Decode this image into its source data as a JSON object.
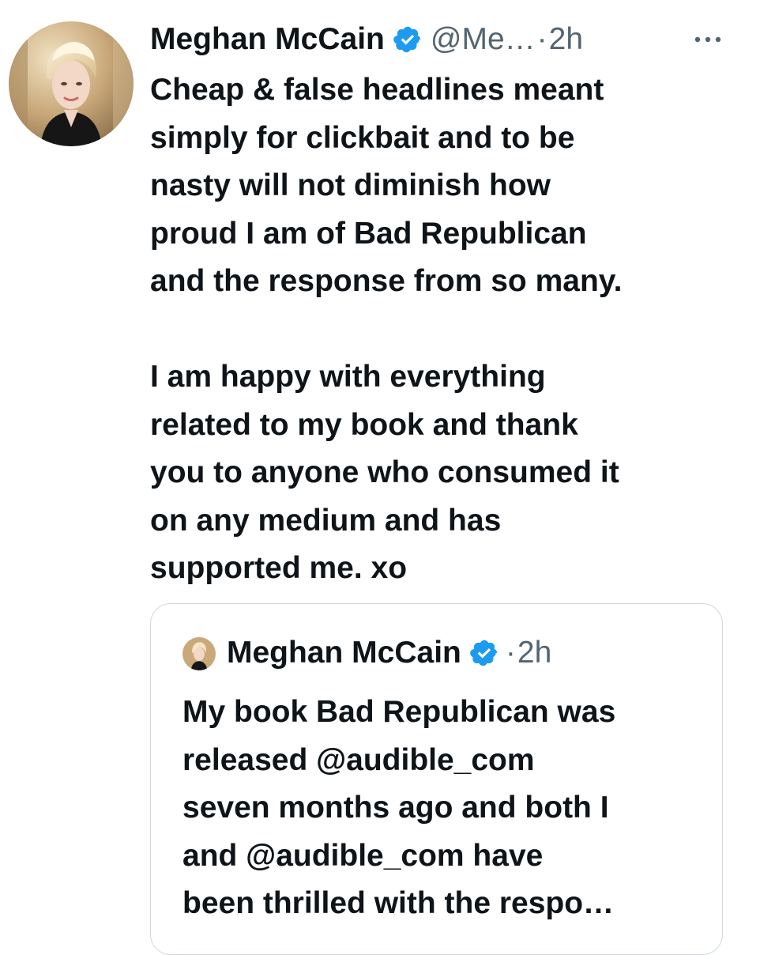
{
  "tweet": {
    "author_name": "Meghan McCain",
    "handle": "@Me…",
    "separator": "·",
    "time": "2h",
    "body_lines": [
      "Cheap & false headlines meant",
      "simply for clickbait and to be",
      "nasty will not diminish how",
      "proud I am of Bad Republican",
      "and the response from so many."
    ],
    "body_lines_2": [
      "I am happy with everything",
      "related to my book and thank",
      "you to anyone who consumed it",
      "on any medium and has",
      "supported me. xo"
    ]
  },
  "quoted_tweet": {
    "author_name": "Meghan McCain",
    "separator": "·",
    "time": "2h",
    "body_lines": [
      "My book Bad Republican was",
      "released @audible_com",
      "seven months ago and both I",
      "and @audible_com have",
      "been thrilled with the respo…"
    ]
  },
  "icons": {
    "verified": "verified-badge-icon",
    "more": "more-options-icon",
    "avatar": "profile-avatar"
  },
  "colors": {
    "verified": "#1d9bf0",
    "text": "#0f1419",
    "secondary": "#536471",
    "border": "#cfd9de"
  }
}
